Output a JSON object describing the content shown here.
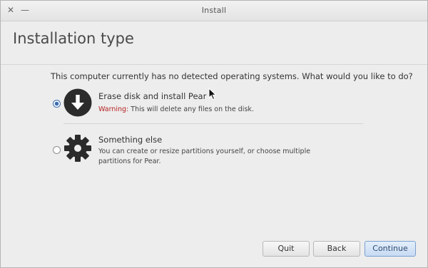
{
  "window": {
    "title": "Install",
    "close_glyph": "✕",
    "minimize_glyph": "—"
  },
  "header": {
    "title": "Installation type"
  },
  "question": "This computer currently has no detected operating systems. What would you like to do?",
  "options": [
    {
      "id": "erase",
      "icon": "download-arrow-icon",
      "title": "Erase disk and install Pear",
      "warning_label": "Warning:",
      "description": "This will delete any files on the disk.",
      "selected": true
    },
    {
      "id": "something_else",
      "icon": "gear-icon",
      "title": "Something else",
      "description_line1": "You can create or resize partitions yourself, or choose multiple",
      "description_line2": "partitions for Pear.",
      "selected": false
    }
  ],
  "buttons": {
    "quit": "Quit",
    "back": "Back",
    "continue": "Continue"
  },
  "colors": {
    "accent": "#3b6db3",
    "warning": "#b52424",
    "icon_dark": "#2b2b2b"
  }
}
